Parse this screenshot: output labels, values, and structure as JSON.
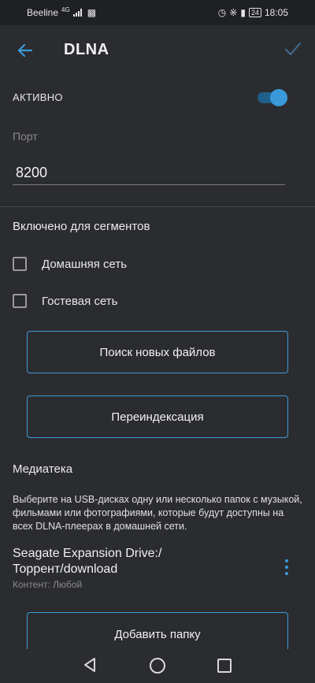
{
  "statusbar": {
    "carrier": "Beeline",
    "network": "4G",
    "battery": "24",
    "time": "18:05"
  },
  "appbar": {
    "title": "DLNA",
    "back_icon": "arrow-left-icon",
    "confirm_icon": "check-icon"
  },
  "active": {
    "label": "АКТИВНО",
    "enabled": true
  },
  "port": {
    "label": "Порт",
    "value": "8200"
  },
  "segments": {
    "title": "Включено для сегментов",
    "items": [
      {
        "label": "Домашняя сеть",
        "checked": false
      },
      {
        "label": "Гостевая сеть",
        "checked": false
      }
    ]
  },
  "buttons": {
    "scan_label": "Поиск новых файлов",
    "reindex_label": "Переиндексация",
    "add_folder_label": "Добавить папку"
  },
  "media": {
    "title": "Медиатека",
    "description": "Выберите на USB-дисках одну или несколько папок с музыкой, фильмами или фотографиями, которые будут доступны на всех DLNA-плеерах в домашней сети.",
    "folders": [
      {
        "path": "Seagate Expansion Drive:/Торрент/download",
        "content": "Контент: Любой"
      }
    ]
  },
  "colors": {
    "accent": "#3a9ad9",
    "background": "#2b2c30"
  }
}
